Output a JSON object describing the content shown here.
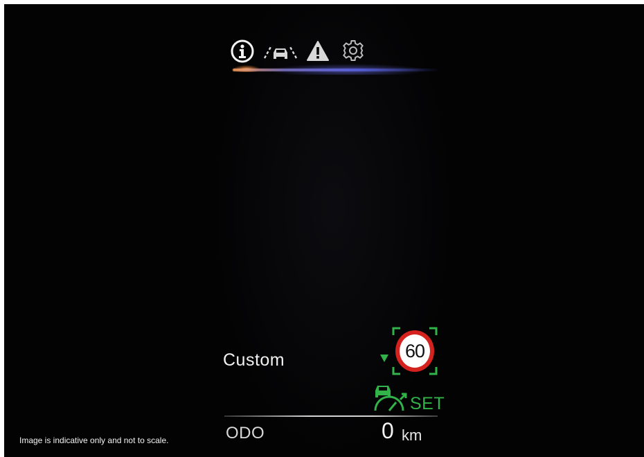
{
  "tabs": [
    {
      "icon": "info-icon",
      "active": true
    },
    {
      "icon": "lane-assist-icon",
      "active": false
    },
    {
      "icon": "warning-icon",
      "active": false
    },
    {
      "icon": "settings-icon",
      "active": false
    }
  ],
  "drive_mode": {
    "label": "Custom"
  },
  "speed_limit": {
    "value": "60",
    "indicator": "arrow-down-icon"
  },
  "cruise_control": {
    "status": "SET",
    "icon": "cruise-control-icon"
  },
  "odometer": {
    "label": "ODO",
    "value": "0",
    "unit": "km"
  },
  "disclaimer": "Image is indicative only and not to scale.",
  "colors": {
    "background": "#030304",
    "accent_green": "#31b34a",
    "sign_red": "#d4221f",
    "tab_glow_orange": "#ffa05a",
    "tab_glow_blue": "#5a64e6",
    "text": "#f2f2f2"
  }
}
